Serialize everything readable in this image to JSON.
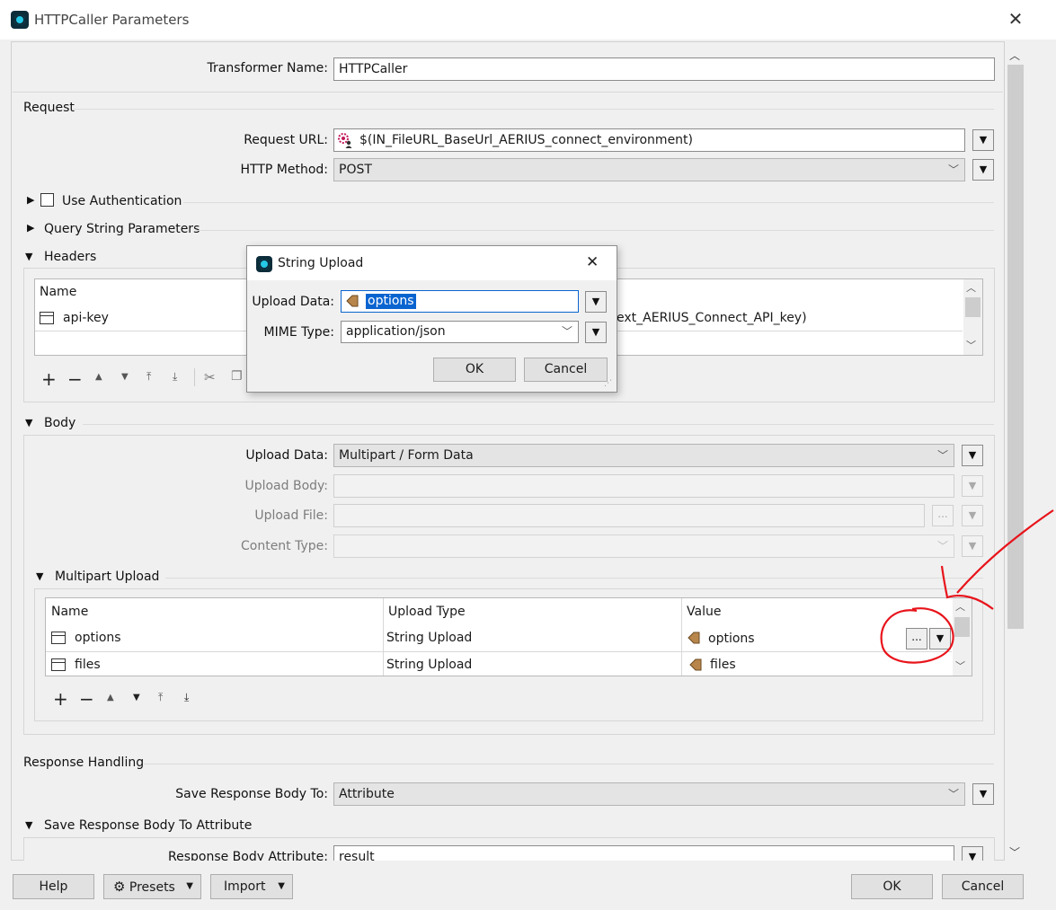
{
  "window": {
    "title": "HTTPCaller Parameters",
    "close_glyph": "✕"
  },
  "transformer": {
    "label": "Transformer Name:",
    "value": "HTTPCaller"
  },
  "request": {
    "section_title": "Request",
    "url_label": "Request URL:",
    "url_value": "$(IN_FileURL_BaseUrl_AERIUS_connect_environment)",
    "method_label": "HTTP Method:",
    "method_value": "POST",
    "use_auth_label": "Use Authentication",
    "query_label": "Query String Parameters",
    "headers_label": "Headers",
    "headers_table": {
      "col_name": "Name",
      "rows": [
        {
          "name": "api-key",
          "value_visible": "ext_AERIUS_Connect_API_key)"
        }
      ]
    }
  },
  "body": {
    "section_title": "Body",
    "upload_data_label": "Upload Data:",
    "upload_data_value": "Multipart / Form Data",
    "upload_body_label": "Upload Body:",
    "upload_file_label": "Upload File:",
    "content_type_label": "Content Type:",
    "multipart_label": "Multipart Upload",
    "multipart_table": {
      "col_name": "Name",
      "col_type": "Upload Type",
      "col_value": "Value",
      "rows": [
        {
          "name": "options",
          "type": "String Upload",
          "value": "options"
        },
        {
          "name": "files",
          "type": "String Upload",
          "value": "files"
        }
      ]
    }
  },
  "response": {
    "section_title": "Response Handling",
    "save_to_label": "Save Response Body To:",
    "save_to_value": "Attribute",
    "save_attr_section": "Save Response Body To Attribute",
    "attr_label": "Response Body Attribute:",
    "attr_value": "result"
  },
  "footer": {
    "help": "Help",
    "presets": "Presets",
    "import": "Import",
    "ok": "OK",
    "cancel": "Cancel"
  },
  "dialog": {
    "title": "String Upload",
    "close_glyph": "✕",
    "upload_label": "Upload Data:",
    "upload_value": "options",
    "mime_label": "MIME Type:",
    "mime_value": "application/json",
    "ok": "OK",
    "cancel": "Cancel"
  },
  "ellipsis": "...",
  "colors": {
    "accent_select": "#0a64d0",
    "annotation": "#e8141b",
    "attr_icon": "#b8864b"
  },
  "icons": [
    "app-icon",
    "close-icon",
    "user-param-icon",
    "attribute-icon",
    "chevron-down-icon",
    "triangle-right-icon",
    "triangle-down-icon",
    "gear-icon",
    "add-icon",
    "remove-icon",
    "cut-icon",
    "copy-icon"
  ]
}
